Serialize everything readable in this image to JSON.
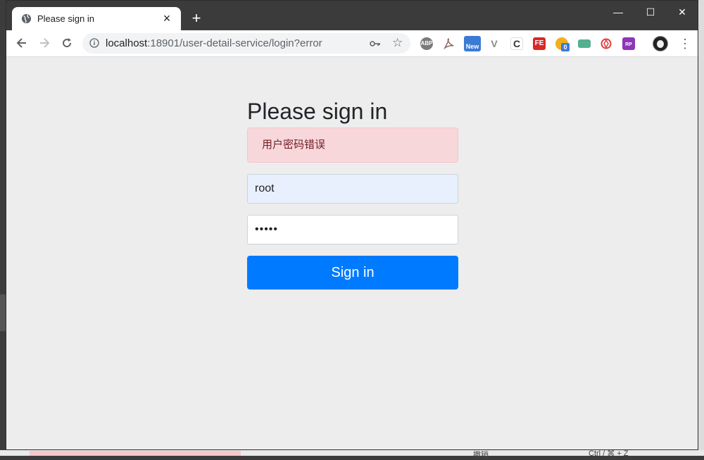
{
  "browser": {
    "tab_title": "Please sign in",
    "new_tab_symbol": "+",
    "close_symbol": "×",
    "window_controls": {
      "minimize": "—",
      "maximize": "☐",
      "close": "✕"
    },
    "url_host": "localhost",
    "url_rest": ":18901/user-detail-service/login?error",
    "extensions": [
      {
        "name": "abp-icon",
        "text": "ABP",
        "color": "#7a7a7a"
      },
      {
        "name": "pdf-icon",
        "text": "",
        "color": "#8a6b62"
      },
      {
        "name": "new-extension-icon",
        "text": "New",
        "color": "#3b7bd6"
      },
      {
        "name": "vue-devtools-icon",
        "text": "V",
        "color": "#8a8a8a"
      },
      {
        "name": "c-extension-icon",
        "text": "C",
        "color": "#ffffff"
      },
      {
        "name": "fe-helper-icon",
        "text": "FE",
        "color": "#d92828"
      },
      {
        "name": "todo-extension-icon",
        "text": "0",
        "color": "#f2b01e"
      },
      {
        "name": "green-box-icon",
        "text": "",
        "color": "#52b08f"
      },
      {
        "name": "lastpass-icon",
        "text": "",
        "color": "#e23c3c"
      },
      {
        "name": "rp-icon",
        "text": "RP",
        "color": "#8f35b8"
      }
    ]
  },
  "page": {
    "heading": "Please sign in",
    "error_message": "用户密码错误",
    "username_value": "root",
    "password_value": "•••••",
    "submit_label": "Sign in"
  },
  "background": {
    "bottom_text_left": "撤销",
    "bottom_text_right": "Ctrl / ⌘ + Z"
  },
  "colors": {
    "primary": "#007bff",
    "alert_bg": "#f8d7da",
    "alert_text": "#721c24",
    "autofill_bg": "#e8f0fe"
  }
}
